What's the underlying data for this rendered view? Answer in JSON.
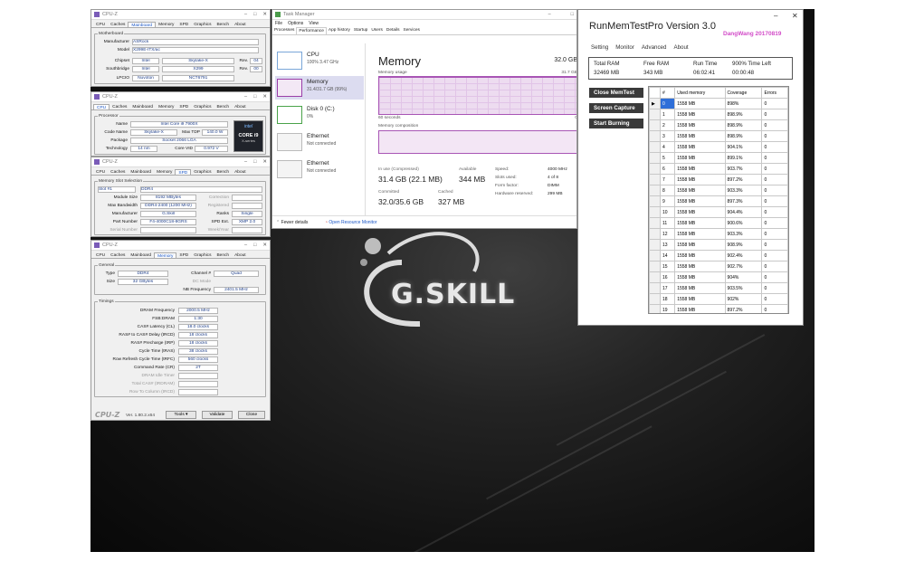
{
  "cpuz_common": {
    "title": "CPU-Z",
    "tabs": [
      "CPU",
      "Caches",
      "Mainboard",
      "Memory",
      "SPD",
      "Graphics",
      "Bench",
      "About"
    ]
  },
  "cpuz1": {
    "active_tab": "Mainboard",
    "group": "Motherboard",
    "manufacturer_label": "Manufacturer",
    "manufacturer": "ASRock",
    "model_label": "Model",
    "model": "X299E-ITX/ac",
    "chipset_label": "Chipset",
    "chipset_vendor": "Intel",
    "chipset_model": "Skylake-X",
    "chipset_rev_label": "Rev.",
    "chipset_rev": "04",
    "southbridge_label": "Southbridge",
    "sb_vendor": "Intel",
    "sb_model": "X299",
    "sb_rev_label": "Rev.",
    "sb_rev": "00",
    "lpcio_label": "LPCIO",
    "lpcio_vendor": "Nuvoton",
    "lpcio_model": "NCT6791"
  },
  "cpuz2": {
    "active_tab": "CPU",
    "group": "Processor",
    "name_label": "Name",
    "name": "Intel Core i9 7900X",
    "codename_label": "Code Name",
    "codename": "Skylake-X",
    "maxtdp_label": "Max TDP",
    "maxtdp": "140.0 W",
    "package_label": "Package",
    "package": "Socket 2066 LGA",
    "technology_label": "Technology",
    "technology": "14 nm",
    "corevid_label": "Core VID",
    "corevid": "0.972 V",
    "badge_brand": "intel",
    "badge_line1": "CORE i9",
    "badge_line2": "X-series"
  },
  "cpuz3": {
    "active_tab": "SPD",
    "group": "Memory Slot Selection",
    "slot": "Slot #1",
    "type": "DDR4",
    "module_size_label": "Module Size",
    "module_size": "8192 MBytes",
    "correction_label": "Correction",
    "max_bw_label": "Max Bandwidth",
    "max_bw": "DDR4-2400 (1200 MHz)",
    "registered_label": "Registered",
    "manufacturer_label": "Manufacturer",
    "manufacturer": "G.Skill",
    "ranks_label": "Ranks",
    "ranks": "Single",
    "part_label": "Part Number",
    "part": "F4-4000C18-8GRS",
    "spd_ext_label": "SPD Ext.",
    "spd_ext": "XMP 2.0",
    "serial_label": "Serial Number",
    "week_label": "Week/Year"
  },
  "cpuz4": {
    "active_tab": "Memory",
    "general_group": "General",
    "type_label": "Type",
    "type": "DDR4",
    "channel_label": "Channel #",
    "channel": "Quad",
    "size_label": "Size",
    "size": "32 GBytes",
    "dc_mode_label": "DC Mode",
    "nb_freq_label": "NB Frequency",
    "nb_freq": "2401.5 MHz",
    "timings_group": "Timings",
    "timings": [
      {
        "label": "DRAM Frequency",
        "value": "2000.5 MHz"
      },
      {
        "label": "FSB:DRAM",
        "value": "1:30"
      },
      {
        "label": "CAS# Latency (CL)",
        "value": "18.0 clocks"
      },
      {
        "label": "RAS# to CAS# Delay (tRCD)",
        "value": "18 clocks"
      },
      {
        "label": "RAS# Precharge (tRP)",
        "value": "18 clocks"
      },
      {
        "label": "Cycle Time (tRAS)",
        "value": "38 clocks"
      },
      {
        "label": "Row Refresh Cycle Time (tRFC)",
        "value": "560 clocks"
      },
      {
        "label": "Command Rate (CR)",
        "value": "2T"
      },
      {
        "label": "DRAM Idle Timer",
        "value": ""
      },
      {
        "label": "Total CAS# (tRDRAM)",
        "value": ""
      },
      {
        "label": "Row To Column (tRCD)",
        "value": ""
      }
    ],
    "footer_logo": "CPU-Z",
    "version": "Ver. 1.80.2.x64",
    "tools_btn": "Tools",
    "validate_btn": "Validate",
    "close_btn": "Close"
  },
  "taskmgr": {
    "title": "Task Manager",
    "menu": [
      "File",
      "Options",
      "View"
    ],
    "tabs": [
      "Processes",
      "Performance",
      "App history",
      "Startup",
      "Users",
      "Details",
      "Services"
    ],
    "active_tab": "Performance",
    "side": [
      {
        "name": "CPU",
        "sub": "100% 3.47 GHz"
      },
      {
        "name": "Memory",
        "sub": "31.4/31.7 GB (99%)"
      },
      {
        "name": "Disk 0 (C:)",
        "sub": "0%"
      },
      {
        "name": "Ethernet",
        "sub": "Not connected"
      },
      {
        "name": "Ethernet",
        "sub": "Not connected"
      }
    ],
    "heading": "Memory",
    "total": "32.0 GB",
    "usage_label": "Memory usage",
    "usage_max": "31.7 GB",
    "seconds_label": "60 seconds",
    "zero": "0",
    "composition_label": "Memory composition",
    "in_use_label": "In use (Compressed)",
    "in_use": "31.4 GB (22.1 MB)",
    "available_label": "Available",
    "available": "344 MB",
    "committed_label": "Committed",
    "committed": "32.0/35.6 GB",
    "cached_label": "Cached",
    "cached": "327 MB",
    "details": [
      {
        "k": "Speed:",
        "v": "4000 MHz"
      },
      {
        "k": "Slots used:",
        "v": "4 of 8"
      },
      {
        "k": "Form factor:",
        "v": "DIMM"
      },
      {
        "k": "Hardware reserved:",
        "v": "299 MB"
      }
    ],
    "fewer_details": "Fewer details",
    "open_monitor": "Open Resource Monitor",
    "usage_fill": 0.99
  },
  "desktop": {
    "brand": "G.SKILL"
  },
  "runmem": {
    "title": "RunMemTestPro Version 3.0",
    "author": "DangWang  20170819",
    "menu": [
      "Setting",
      "Monitor",
      "Advanced",
      "About"
    ],
    "summary_headers": [
      "Total RAM",
      "Free RAM",
      "Run Time",
      "900% Time Left"
    ],
    "summary_values": [
      "32469 MB",
      "343 MB",
      "06:02:41",
      "00:00:48"
    ],
    "buttons": [
      "Close MemTest",
      "Screen Capture",
      "Start Burning"
    ],
    "columns": [
      "#",
      "Used memory",
      "Coverage",
      "Errors"
    ],
    "rows": [
      [
        "0",
        "1558 MB",
        "898%",
        "0"
      ],
      [
        "1",
        "1558 MB",
        "898.9%",
        "0"
      ],
      [
        "2",
        "1558 MB",
        "898.9%",
        "0"
      ],
      [
        "3",
        "1558 MB",
        "898.9%",
        "0"
      ],
      [
        "4",
        "1558 MB",
        "904.1%",
        "0"
      ],
      [
        "5",
        "1558 MB",
        "899.1%",
        "0"
      ],
      [
        "6",
        "1558 MB",
        "903.7%",
        "0"
      ],
      [
        "7",
        "1558 MB",
        "897.2%",
        "0"
      ],
      [
        "8",
        "1558 MB",
        "903.3%",
        "0"
      ],
      [
        "9",
        "1558 MB",
        "897.3%",
        "0"
      ],
      [
        "10",
        "1558 MB",
        "904.4%",
        "0"
      ],
      [
        "11",
        "1558 MB",
        "900.6%",
        "0"
      ],
      [
        "12",
        "1558 MB",
        "903.3%",
        "0"
      ],
      [
        "13",
        "1558 MB",
        "908.9%",
        "0"
      ],
      [
        "14",
        "1558 MB",
        "902.4%",
        "0"
      ],
      [
        "15",
        "1558 MB",
        "902.7%",
        "0"
      ],
      [
        "16",
        "1558 MB",
        "904%",
        "0"
      ],
      [
        "17",
        "1558 MB",
        "903.5%",
        "0"
      ],
      [
        "18",
        "1558 MB",
        "902%",
        "0"
      ],
      [
        "19",
        "1558 MB",
        "897.2%",
        "0"
      ],
      [
        "20",
        "1558 MB",
        "899.4%",
        "0"
      ]
    ]
  }
}
